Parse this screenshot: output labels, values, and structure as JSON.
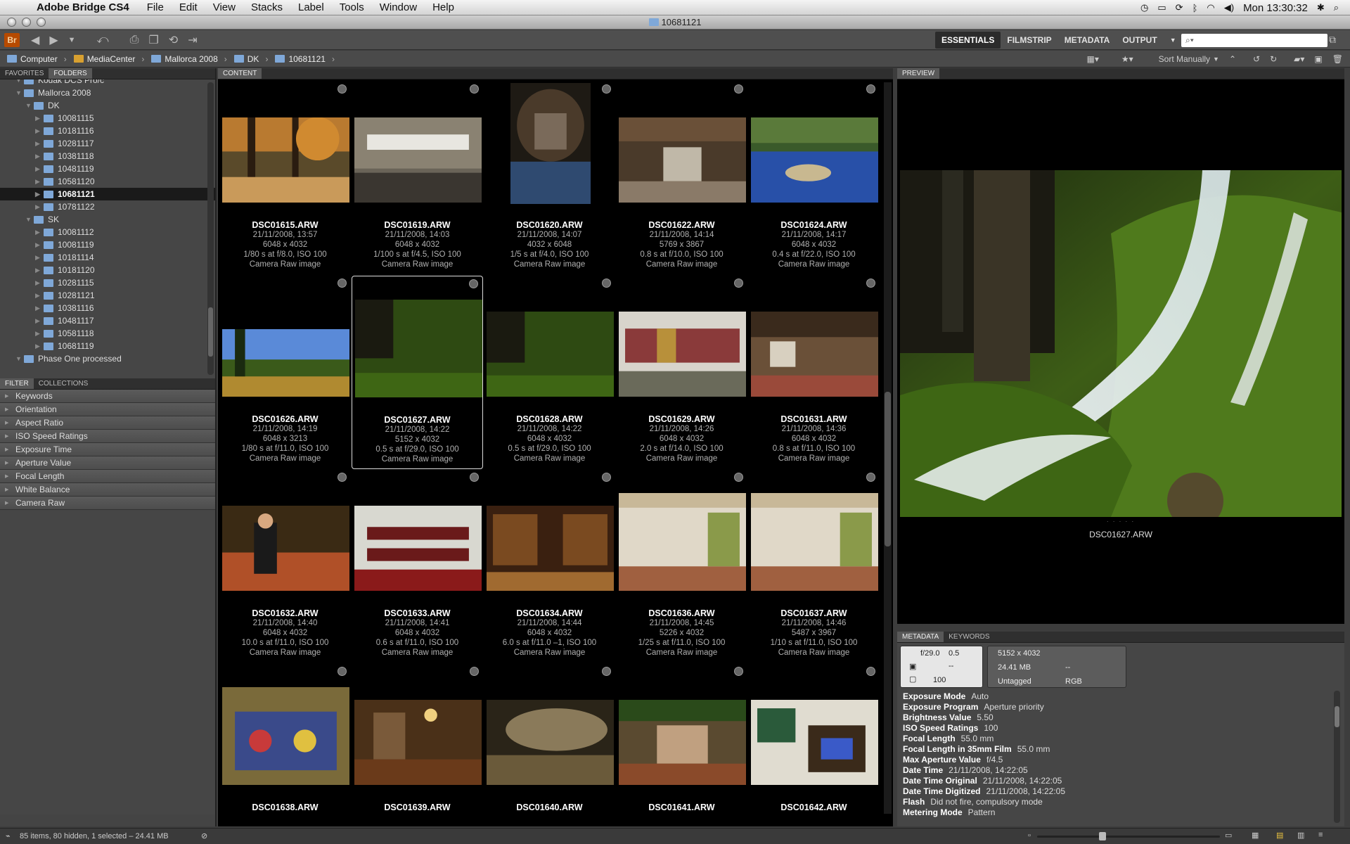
{
  "menubar": {
    "app": "Adobe Bridge CS4",
    "items": [
      "File",
      "Edit",
      "View",
      "Stacks",
      "Label",
      "Tools",
      "Window",
      "Help"
    ],
    "clock": "Mon 13:30:32"
  },
  "window": {
    "title": "10681121"
  },
  "toolbar": {
    "logo": "Br",
    "workspaces": [
      "ESSENTIALS",
      "FILMSTRIP",
      "METADATA",
      "OUTPUT"
    ],
    "active_workspace": "ESSENTIALS"
  },
  "path": [
    "Computer",
    "MediaCenter",
    "Mallorca 2008",
    "DK",
    "10681121"
  ],
  "pathtools": {
    "sort": "Sort Manually"
  },
  "left": {
    "tabs": [
      "FAVORITES",
      "FOLDERS"
    ],
    "active_tab": "FOLDERS",
    "folders": [
      {
        "label": "Kodak DCS Pro/c",
        "indent": 1
      },
      {
        "label": "Mallorca 2008",
        "indent": 1
      },
      {
        "label": "DK",
        "indent": 2
      },
      {
        "label": "10081115",
        "indent": 3
      },
      {
        "label": "10181116",
        "indent": 3
      },
      {
        "label": "10281117",
        "indent": 3
      },
      {
        "label": "10381118",
        "indent": 3
      },
      {
        "label": "10481119",
        "indent": 3
      },
      {
        "label": "10581120",
        "indent": 3
      },
      {
        "label": "10681121",
        "indent": 3,
        "selected": true
      },
      {
        "label": "10781122",
        "indent": 3
      },
      {
        "label": "SK",
        "indent": 2
      },
      {
        "label": "10081112",
        "indent": 3
      },
      {
        "label": "10081119",
        "indent": 3
      },
      {
        "label": "10181114",
        "indent": 3
      },
      {
        "label": "10181120",
        "indent": 3
      },
      {
        "label": "10281115",
        "indent": 3
      },
      {
        "label": "10281121",
        "indent": 3
      },
      {
        "label": "10381116",
        "indent": 3
      },
      {
        "label": "10481117",
        "indent": 3
      },
      {
        "label": "10581118",
        "indent": 3
      },
      {
        "label": "10681119",
        "indent": 3
      },
      {
        "label": "Phase One processed",
        "indent": 1
      }
    ],
    "filter_tabs": [
      "FILTER",
      "COLLECTIONS"
    ],
    "filters": [
      "Keywords",
      "Orientation",
      "Aspect Ratio",
      "ISO Speed Ratings",
      "Exposure Time",
      "Aperture Value",
      "Focal Length",
      "White Balance",
      "Camera Raw"
    ]
  },
  "content": {
    "tab": "CONTENT",
    "thumbs": [
      {
        "fn": "DSC01615.ARW",
        "date": "21/11/2008, 13:57",
        "dims": "6048 x 4032",
        "exp": "1/80 s at f/8.0, ISO 100",
        "type": "Camera Raw image",
        "scene": "autumn",
        "orient": "land"
      },
      {
        "fn": "DSC01619.ARW",
        "date": "21/11/2008, 14:03",
        "dims": "6048 x 4032",
        "exp": "1/100 s at f/4.5, ISO 100",
        "type": "Camera Raw image",
        "scene": "stone",
        "orient": "land"
      },
      {
        "fn": "DSC01620.ARW",
        "date": "21/11/2008, 14:07",
        "dims": "4032 x 6048",
        "exp": "1/5 s at f/4.0, ISO 100",
        "type": "Camera Raw image",
        "scene": "well",
        "orient": "port"
      },
      {
        "fn": "DSC01622.ARW",
        "date": "21/11/2008, 14:14",
        "dims": "5769 x 3867",
        "exp": "0.8 s at f/10.0, ISO 100",
        "type": "Camera Raw image",
        "scene": "barn",
        "orient": "land"
      },
      {
        "fn": "DSC01624.ARW",
        "date": "21/11/2008, 14:17",
        "dims": "6048 x 4032",
        "exp": "0.4 s at f/22.0, ISO 100",
        "type": "Camera Raw image",
        "scene": "tiles",
        "orient": "land"
      },
      {
        "fn": "DSC01626.ARW",
        "date": "21/11/2008, 14:19",
        "dims": "6048 x 3213",
        "exp": "1/80 s at f/11.0, ISO 100",
        "type": "Camera Raw image",
        "scene": "sky",
        "orient": "pano"
      },
      {
        "fn": "DSC01627.ARW",
        "date": "21/11/2008, 14:22",
        "dims": "5152 x 4032",
        "exp": "0.5 s at f/29.0, ISO 100",
        "type": "Camera Raw image",
        "scene": "falls",
        "orient": "square",
        "selected": true
      },
      {
        "fn": "DSC01628.ARW",
        "date": "21/11/2008, 14:22",
        "dims": "6048 x 4032",
        "exp": "0.5 s at f/29.0, ISO 100",
        "type": "Camera Raw image",
        "scene": "falls",
        "orient": "land"
      },
      {
        "fn": "DSC01629.ARW",
        "date": "21/11/2008, 14:26",
        "dims": "6048 x 4032",
        "exp": "2.0 s at f/14.0, ISO 100",
        "type": "Camera Raw image",
        "scene": "wool",
        "orient": "land"
      },
      {
        "fn": "DSC01631.ARW",
        "date": "21/11/2008, 14:36",
        "dims": "6048 x 4032",
        "exp": "0.8 s at f/11.0, ISO 100",
        "type": "Camera Raw image",
        "scene": "room",
        "orient": "land"
      },
      {
        "fn": "DSC01632.ARW",
        "date": "21/11/2008, 14:40",
        "dims": "6048 x 4032",
        "exp": "10.0 s at f/11.0, ISO 100",
        "type": "Camera Raw image",
        "scene": "lady",
        "orient": "land"
      },
      {
        "fn": "DSC01633.ARW",
        "date": "21/11/2008, 14:41",
        "dims": "6048 x 4032",
        "exp": "0.6 s at f/11.0, ISO 100",
        "type": "Camera Raw image",
        "scene": "theatre",
        "orient": "land"
      },
      {
        "fn": "DSC01634.ARW",
        "date": "21/11/2008, 14:44",
        "dims": "6048 x 4032",
        "exp": "6.0 s at f/11.0 –1, ISO 100",
        "type": "Camera Raw image",
        "scene": "library",
        "orient": "land"
      },
      {
        "fn": "DSC01636.ARW",
        "date": "21/11/2008, 14:45",
        "dims": "5226 x 4032",
        "exp": "1/25 s at f/11.0, ISO 100",
        "type": "Camera Raw image",
        "scene": "arcade",
        "orient": "square"
      },
      {
        "fn": "DSC01637.ARW",
        "date": "21/11/2008, 14:46",
        "dims": "5487 x 3967",
        "exp": "1/10 s at f/11.0, ISO 100",
        "type": "Camera Raw image",
        "scene": "arcade",
        "orient": "square"
      },
      {
        "fn": "DSC01638.ARW",
        "date": "",
        "dims": "",
        "exp": "",
        "type": "",
        "scene": "puppets",
        "orient": "square"
      },
      {
        "fn": "DSC01639.ARW",
        "date": "",
        "dims": "",
        "exp": "",
        "type": "",
        "scene": "dining",
        "orient": "land"
      },
      {
        "fn": "DSC01640.ARW",
        "date": "",
        "dims": "",
        "exp": "",
        "type": "",
        "scene": "press",
        "orient": "land"
      },
      {
        "fn": "DSC01641.ARW",
        "date": "",
        "dims": "",
        "exp": "",
        "type": "",
        "scene": "court",
        "orient": "land"
      },
      {
        "fn": "DSC01642.ARW",
        "date": "",
        "dims": "",
        "exp": "",
        "type": "",
        "scene": "loom",
        "orient": "land"
      }
    ]
  },
  "preview": {
    "tab": "PREVIEW",
    "caption": "DSC01627.ARW"
  },
  "metadata": {
    "tabs": [
      "METADATA",
      "KEYWORDS"
    ],
    "box1": {
      "aperture": "f/29.0",
      "shutter": "0.5",
      "metering": "--",
      "iso": "100"
    },
    "box2": {
      "dims": "5152 x 4032",
      "size": "24.41 MB",
      "dash": "--",
      "tag": "Untagged",
      "color": "RGB"
    },
    "rows": [
      {
        "k": "Exposure Mode",
        "v": "Auto"
      },
      {
        "k": "Exposure Program",
        "v": "Aperture priority"
      },
      {
        "k": "Brightness Value",
        "v": "5.50"
      },
      {
        "k": "ISO Speed Ratings",
        "v": "100"
      },
      {
        "k": "Focal Length",
        "v": "55.0 mm"
      },
      {
        "k": "Focal Length in 35mm Film",
        "v": "55.0 mm"
      },
      {
        "k": "Max Aperture Value",
        "v": "f/4.5"
      },
      {
        "k": "Date Time",
        "v": "21/11/2008, 14:22:05"
      },
      {
        "k": "Date Time Original",
        "v": "21/11/2008, 14:22:05"
      },
      {
        "k": "Date Time Digitized",
        "v": "21/11/2008, 14:22:05"
      },
      {
        "k": "Flash",
        "v": "Did not fire, compulsory mode"
      },
      {
        "k": "Metering Mode",
        "v": "Pattern"
      }
    ]
  },
  "status": {
    "text": "85 items, 80 hidden, 1 selected – 24.41 MB",
    "thumb_size": 0.35
  },
  "colors": {
    "accent": "#b74a00",
    "folder": "#7fa8d8",
    "selection": "#1a1a1a"
  }
}
